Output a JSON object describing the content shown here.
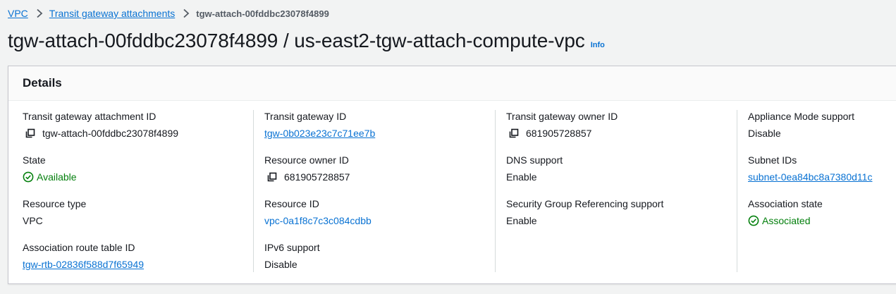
{
  "breadcrumb": {
    "items": [
      "VPC",
      "Transit gateway attachments"
    ],
    "current": "tgw-attach-00fddbc23078f4899"
  },
  "header": {
    "title": "tgw-attach-00fddbc23078f4899 / us-east2-tgw-attach-compute-vpc",
    "info": "Info"
  },
  "details": {
    "title": "Details",
    "columns": [
      [
        {
          "label": "Transit gateway attachment ID",
          "value": "tgw-attach-00fddbc23078f4899"
        },
        {
          "label": "State",
          "value": "Available"
        },
        {
          "label": "Resource type",
          "value": "VPC"
        },
        {
          "label": "Association route table ID",
          "value": "tgw-rtb-02836f588d7f65949"
        }
      ],
      [
        {
          "label": "Transit gateway ID",
          "value": "tgw-0b023e23c7c71ee7b"
        },
        {
          "label": "Resource owner ID",
          "value": "681905728857"
        },
        {
          "label": "Resource ID",
          "value": "vpc-0a1f8c7c3c084cdbb"
        },
        {
          "label": "IPv6 support",
          "value": "Disable"
        }
      ],
      [
        {
          "label": "Transit gateway owner ID",
          "value": "681905728857"
        },
        {
          "label": "DNS support",
          "value": "Enable"
        },
        {
          "label": "Security Group Referencing support",
          "value": "Enable"
        }
      ],
      [
        {
          "label": "Appliance Mode support",
          "value": "Disable"
        },
        {
          "label": "Subnet IDs",
          "value": "subnet-0ea84bc8a7380d11c"
        },
        {
          "label": "Association state",
          "value": "Associated"
        }
      ]
    ]
  },
  "colors": {
    "link": "#0972d3",
    "success": "#037f0c",
    "text": "#16191f"
  },
  "icons": {
    "copy": "copy-icon",
    "success": "check-circle-icon",
    "separator": "chevron-right-icon"
  }
}
